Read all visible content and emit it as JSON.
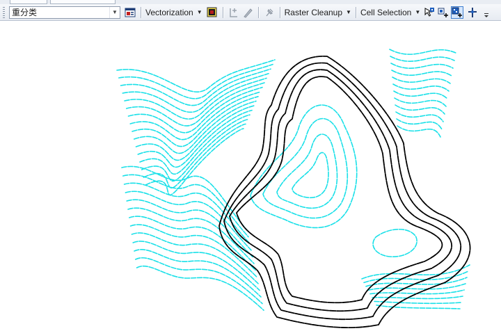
{
  "window": {},
  "toolbar": {
    "layer_combo": {
      "value": "重分类"
    },
    "vectorization": {
      "label": "Vectorization"
    },
    "raster_cleanup": {
      "label": "Raster Cleanup"
    },
    "cell_selection": {
      "label": "Cell Selection"
    }
  },
  "icons": {
    "properties": "layer-properties-icon",
    "raster_view": "raster-view-icon",
    "sketch_new": "new-sketch-icon",
    "pen": "pen-icon",
    "pin": "pin-icon",
    "select_connected": "select-connected-cells-icon",
    "add_cells": "add-cells-icon",
    "select_cells": "select-cells-icon",
    "pan": "pan-cross-icon",
    "overflow": "toolbar-overflow-icon"
  },
  "map": {
    "background": "#ffffff",
    "contour_color_cyan": "#19e0e8",
    "contour_color_black": "#000000"
  }
}
